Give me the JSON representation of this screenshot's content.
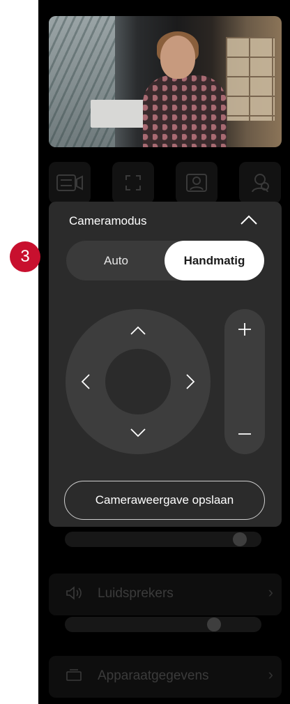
{
  "step_badge": "3",
  "camera_card": {
    "title": "Cameramodus",
    "mode_options": [
      "Auto",
      "Handmatig"
    ],
    "selected_mode": "Handmatig",
    "save_label": "Cameraweergave opslaan"
  },
  "background": {
    "speakers_label": "Luidsprekers",
    "device_info_label": "Apparaatgegevens",
    "upper_slider_level": 0.92,
    "speaker_slider_level": 0.78
  },
  "colors": {
    "badge": "#c8102e",
    "card": "#2b2b2b",
    "selected_segment": "#ffffff"
  }
}
